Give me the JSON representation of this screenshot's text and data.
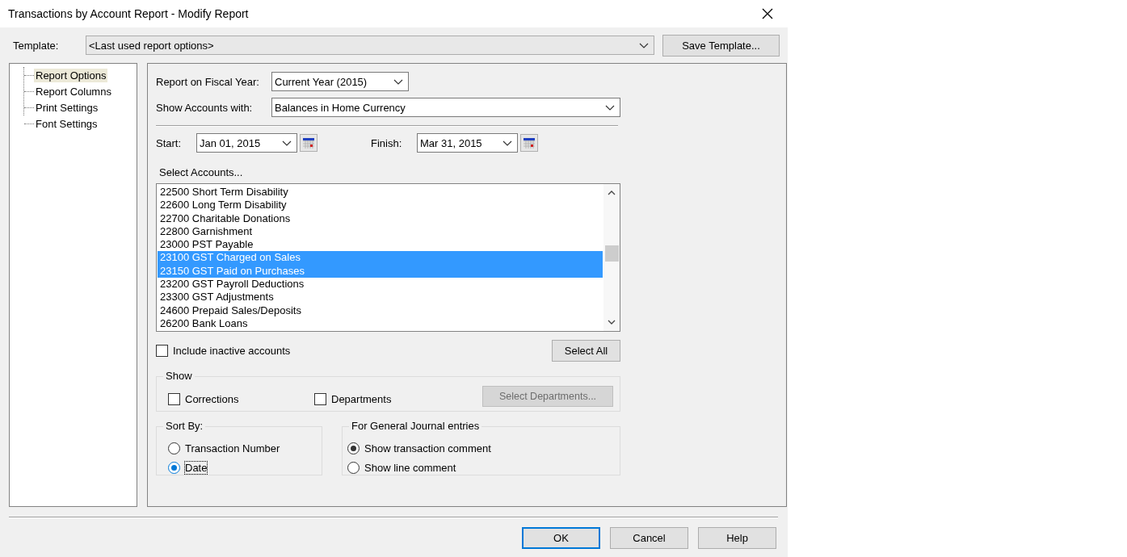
{
  "window": {
    "title": "Transactions by Account Report - Modify Report"
  },
  "template": {
    "label": "Template:",
    "value": "<Last used report options>",
    "save_button": "Save Template..."
  },
  "tree": [
    {
      "label": "Report Options",
      "selected": true
    },
    {
      "label": "Report Columns",
      "selected": false
    },
    {
      "label": "Print Settings",
      "selected": false
    },
    {
      "label": "Font Settings",
      "selected": false
    }
  ],
  "fiscal_year": {
    "label": "Report on Fiscal Year:",
    "value": "Current Year (2015)"
  },
  "show_accounts": {
    "label": "Show Accounts with:",
    "value": "Balances in Home Currency"
  },
  "start": {
    "label": "Start:",
    "value": "Jan 01, 2015"
  },
  "finish": {
    "label": "Finish:",
    "value": "Mar 31, 2015"
  },
  "select_accounts": {
    "label": "Select Accounts...",
    "items": [
      {
        "label": "22500 Short Term Disability",
        "selected": false
      },
      {
        "label": "22600 Long Term Disability",
        "selected": false
      },
      {
        "label": "22700 Charitable Donations",
        "selected": false
      },
      {
        "label": "22800 Garnishment",
        "selected": false
      },
      {
        "label": "23000 PST Payable",
        "selected": false
      },
      {
        "label": "23100 GST Charged on Sales",
        "selected": true
      },
      {
        "label": "23150 GST Paid on Purchases",
        "selected": true
      },
      {
        "label": "23200 GST Payroll Deductions",
        "selected": false
      },
      {
        "label": "23300 GST Adjustments",
        "selected": false
      },
      {
        "label": "24600 Prepaid Sales/Deposits",
        "selected": false
      },
      {
        "label": "26200 Bank Loans",
        "selected": false
      }
    ]
  },
  "include_inactive": {
    "label": "Include inactive accounts",
    "checked": false
  },
  "select_all_button": "Select All",
  "show_group": {
    "title": "Show",
    "options": [
      {
        "label": "Corrections",
        "checked": false
      },
      {
        "label": "Departments",
        "checked": false
      }
    ],
    "select_departments": {
      "label": "Select Departments...",
      "disabled": true
    }
  },
  "sort_by": {
    "title": "Sort By:",
    "options": [
      {
        "label": "Transaction Number",
        "selected": false
      },
      {
        "label": "Date",
        "selected": true
      }
    ]
  },
  "general_journal": {
    "title": "For General Journal entries",
    "options": [
      {
        "label": "Show transaction comment",
        "selected": true
      },
      {
        "label": "Show line comment",
        "selected": false
      }
    ]
  },
  "buttons": [
    {
      "label": "OK",
      "default": true
    },
    {
      "label": "Cancel",
      "default": false
    },
    {
      "label": "Help",
      "default": false
    }
  ]
}
